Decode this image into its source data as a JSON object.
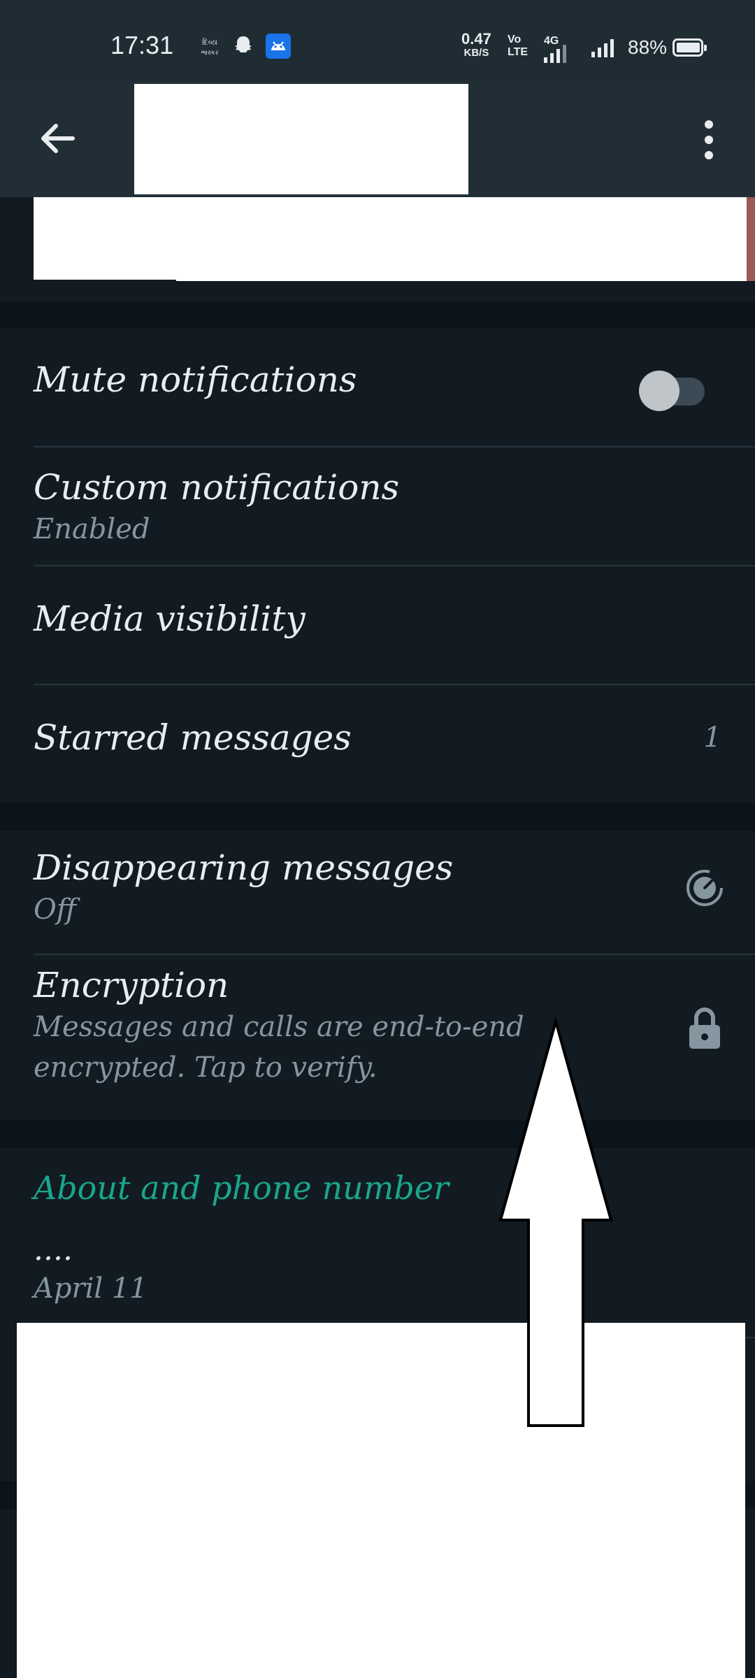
{
  "status_bar": {
    "time": "17:31",
    "net_speed_value": "0.47",
    "net_speed_unit": "KB/S",
    "volte": "Vo\nLTE",
    "network": "4G",
    "battery": "88%",
    "icons": [
      "gujarati-news-icon",
      "snapchat-icon",
      "android-icon"
    ]
  },
  "app_bar": {
    "back_icon": "arrow-left-icon",
    "menu_icon": "more-vert-icon"
  },
  "settings": {
    "mute": {
      "label": "Mute notifications",
      "enabled": false
    },
    "custom": {
      "label": "Custom notifications",
      "value": "Enabled"
    },
    "media": {
      "label": "Media visibility"
    },
    "starred": {
      "label": "Starred messages",
      "count": "1"
    },
    "disappearing": {
      "label": "Disappearing messages",
      "value": "Off",
      "icon": "timer-icon"
    },
    "encryption": {
      "label": "Encryption",
      "line1": "Messages and calls are end-to-end",
      "line2": "encrypted. Tap to verify.",
      "icon": "lock-icon"
    }
  },
  "about": {
    "heading": "About and phone number",
    "status": "....",
    "date": "April 11"
  },
  "colors": {
    "background": "#111b21",
    "app_bar": "#222e35",
    "accent": "#1ba58d",
    "secondary_text": "#8696a0"
  }
}
